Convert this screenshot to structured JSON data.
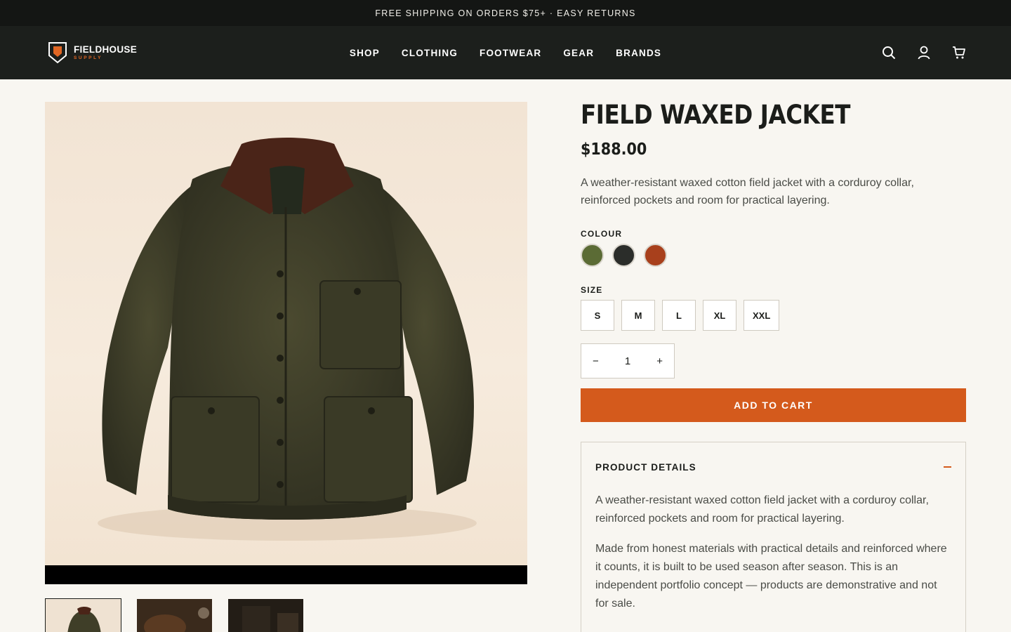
{
  "announcement": "FREE SHIPPING ON ORDERS $75+ · EASY RETURNS",
  "brand": {
    "name": "FIELDHOUSE",
    "sub": "SUPPLY",
    "accent": "#e06623"
  },
  "nav": [
    "SHOP",
    "CLOTHING",
    "FOOTWEAR",
    "GEAR",
    "BRANDS"
  ],
  "header_icons": [
    "search-icon",
    "account-icon",
    "cart-icon"
  ],
  "product": {
    "title": "FIELD WAXED JACKET",
    "price": "$188.00",
    "description": "A weather-resistant waxed cotton field jacket with a corduroy collar, reinforced pockets and room for practical layering.",
    "colour_label": "COLOUR",
    "colours": [
      "#5b6b35",
      "#2b2d2a",
      "#a8401c"
    ],
    "size_label": "SIZE",
    "sizes": [
      "S",
      "M",
      "L",
      "XL",
      "XXL"
    ],
    "quantity": "1",
    "qty_minus": "−",
    "qty_plus": "+",
    "add_to_cart": "ADD TO CART",
    "details_title": "PRODUCT DETAILS",
    "details_para1": "A weather-resistant waxed cotton field jacket with a corduroy collar, reinforced pockets and room for practical layering.",
    "details_para2": "Made from honest materials with practical details and reinforced where it counts, it is built to be used season after season. This is an independent portfolio concept — products are demonstrative and not for sale."
  },
  "colors": {
    "dark_bg": "#1c1f1c",
    "accent": "#d45a1c",
    "page_bg": "#f8f6f1"
  }
}
